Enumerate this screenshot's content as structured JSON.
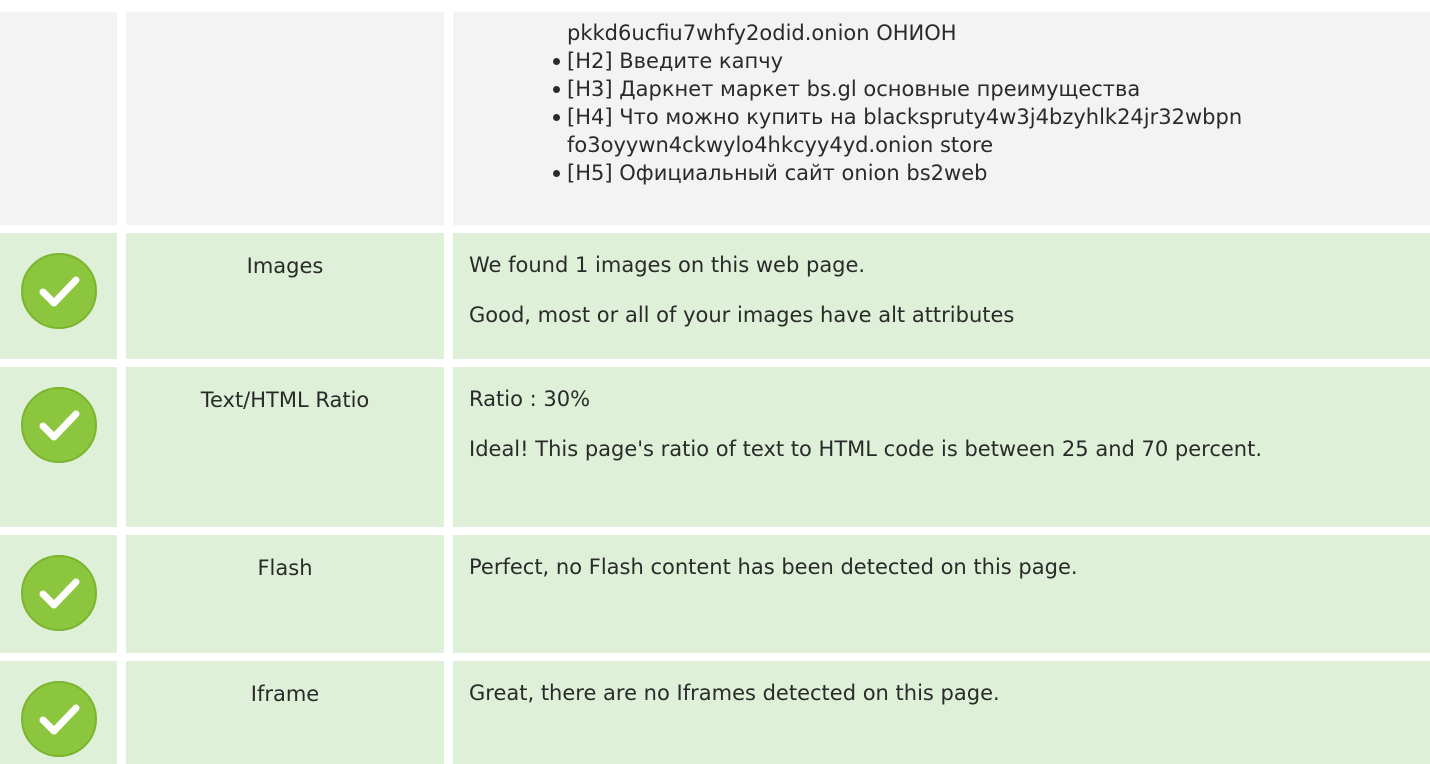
{
  "headings": {
    "carry_line": "pkkd6ucfiu7whfy2odid.onion ОНИОН",
    "items": [
      "[H2] Введите капчу",
      "[H3] Даркнет маркет bs.gl основные преимущества",
      "[H4] Что можно купить на blackspruty4w3j4bzyhlk24jr32wbpn fo3oyywn4ckwylo4hkcyy4yd.onion store",
      "[H5] Официальный сайт onion bs2web"
    ]
  },
  "checks": [
    {
      "label": "Images",
      "status": "pass",
      "lines": [
        "We found 1 images on this web page.",
        "Good, most or all of your images have alt attributes"
      ]
    },
    {
      "label": "Text/HTML Ratio",
      "status": "pass",
      "lines": [
        "Ratio : 30%",
        "Ideal! This page's ratio of text to HTML code is between 25 and 70 percent."
      ]
    },
    {
      "label": "Flash",
      "status": "pass",
      "lines": [
        "Perfect, no Flash content has been detected on this page."
      ]
    },
    {
      "label": "Iframe",
      "status": "pass",
      "lines": [
        "Great, there are no Iframes detected on this page."
      ]
    }
  ],
  "colors": {
    "pass_icon": "#8cc63f",
    "row_green": "#def0d8",
    "row_gray": "#f3f3f3"
  },
  "icons": {
    "pass": "check-circle-icon"
  }
}
